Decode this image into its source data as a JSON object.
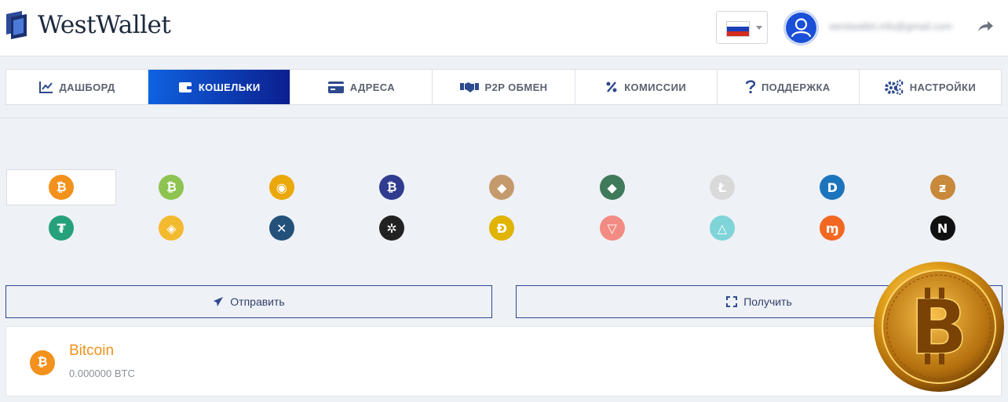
{
  "header": {
    "brand": "WestWallet",
    "email": "westwallet.info@gmail.com"
  },
  "nav": {
    "tabs": [
      {
        "label": "ДАШБОРД",
        "icon": "chart-line-icon"
      },
      {
        "label": "КОШЕЛЬКИ",
        "icon": "wallet-icon",
        "active": true
      },
      {
        "label": "АДРЕСА",
        "icon": "card-icon"
      },
      {
        "label": "P2P ОБМЕН",
        "icon": "handshake-icon"
      },
      {
        "label": "КОМИССИИ",
        "icon": "percent-icon"
      },
      {
        "label": "ПОДДЕРЖКА",
        "icon": "question-icon"
      },
      {
        "label": "НАСТРОЙКИ",
        "icon": "gears-icon"
      }
    ]
  },
  "coins": [
    {
      "name": "btc",
      "color": "#f2911b",
      "glyph": "₿",
      "selected": true
    },
    {
      "name": "bch",
      "color": "#8dc351",
      "glyph": "₿"
    },
    {
      "name": "btg",
      "color": "#eba809",
      "glyph": "◉"
    },
    {
      "name": "wbtc",
      "color": "#2f3c8f",
      "glyph": "₿"
    },
    {
      "name": "eth",
      "color": "#c49a6c",
      "glyph": "◆"
    },
    {
      "name": "etc",
      "color": "#3f7a5a",
      "glyph": "◆"
    },
    {
      "name": "ltc",
      "color": "#d9d9d9",
      "glyph": "Ł"
    },
    {
      "name": "dash",
      "color": "#1c75bc",
      "glyph": "D"
    },
    {
      "name": "zec",
      "color": "#c8893b",
      "glyph": "ƶ"
    },
    {
      "name": "usdt",
      "color": "#26a17b",
      "glyph": "₮"
    },
    {
      "name": "bnb",
      "color": "#f3ba2f",
      "glyph": "◈"
    },
    {
      "name": "xrp",
      "color": "#23517a",
      "glyph": "✕"
    },
    {
      "name": "xlm",
      "color": "#222222",
      "glyph": "✲"
    },
    {
      "name": "doge",
      "color": "#e1b303",
      "glyph": "Ð"
    },
    {
      "name": "trx",
      "color": "#f28b82",
      "glyph": "▽"
    },
    {
      "name": "eos",
      "color": "#7fd4d8",
      "glyph": "△"
    },
    {
      "name": "xmr",
      "color": "#f26822",
      "glyph": "ɱ"
    },
    {
      "name": "near",
      "color": "#111111",
      "glyph": "N"
    }
  ],
  "actions": {
    "send_label": "Отправить",
    "receive_label": "Получить"
  },
  "balance": {
    "name": "Bitcoin",
    "amount": "0.000000 BTC"
  }
}
